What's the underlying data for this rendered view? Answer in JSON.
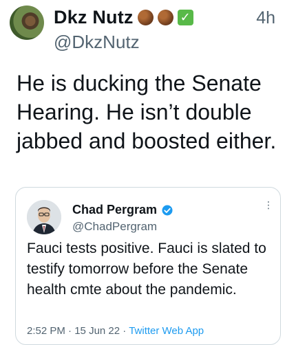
{
  "tweet": {
    "display_name": "Dkz Nutz",
    "handle": "@DkzNutz",
    "time": "4h",
    "check_emoji": "✓",
    "text": "He is ducking the Senate Hearing. He isn’t double jabbed and boosted either."
  },
  "quoted": {
    "display_name": "Chad Pergram",
    "handle": "@ChadPergram",
    "text": "Fauci tests positive. Fauci is slated to testify tomorrow before the Senate health cmte about the pandemic.",
    "time": "2:52 PM",
    "date": "15 Jun 22",
    "separator": "·",
    "source": "Twitter Web App",
    "more_icon": "⋮"
  },
  "colors": {
    "text": "#0f1419",
    "secondary": "#536471",
    "link": "#1d9bf0",
    "border": "#cfd9de",
    "emoji_check": "#58b948"
  },
  "icons": [
    "nut-emoji-icon",
    "check-mark-icon",
    "verified-badge-icon",
    "more-options-icon"
  ]
}
